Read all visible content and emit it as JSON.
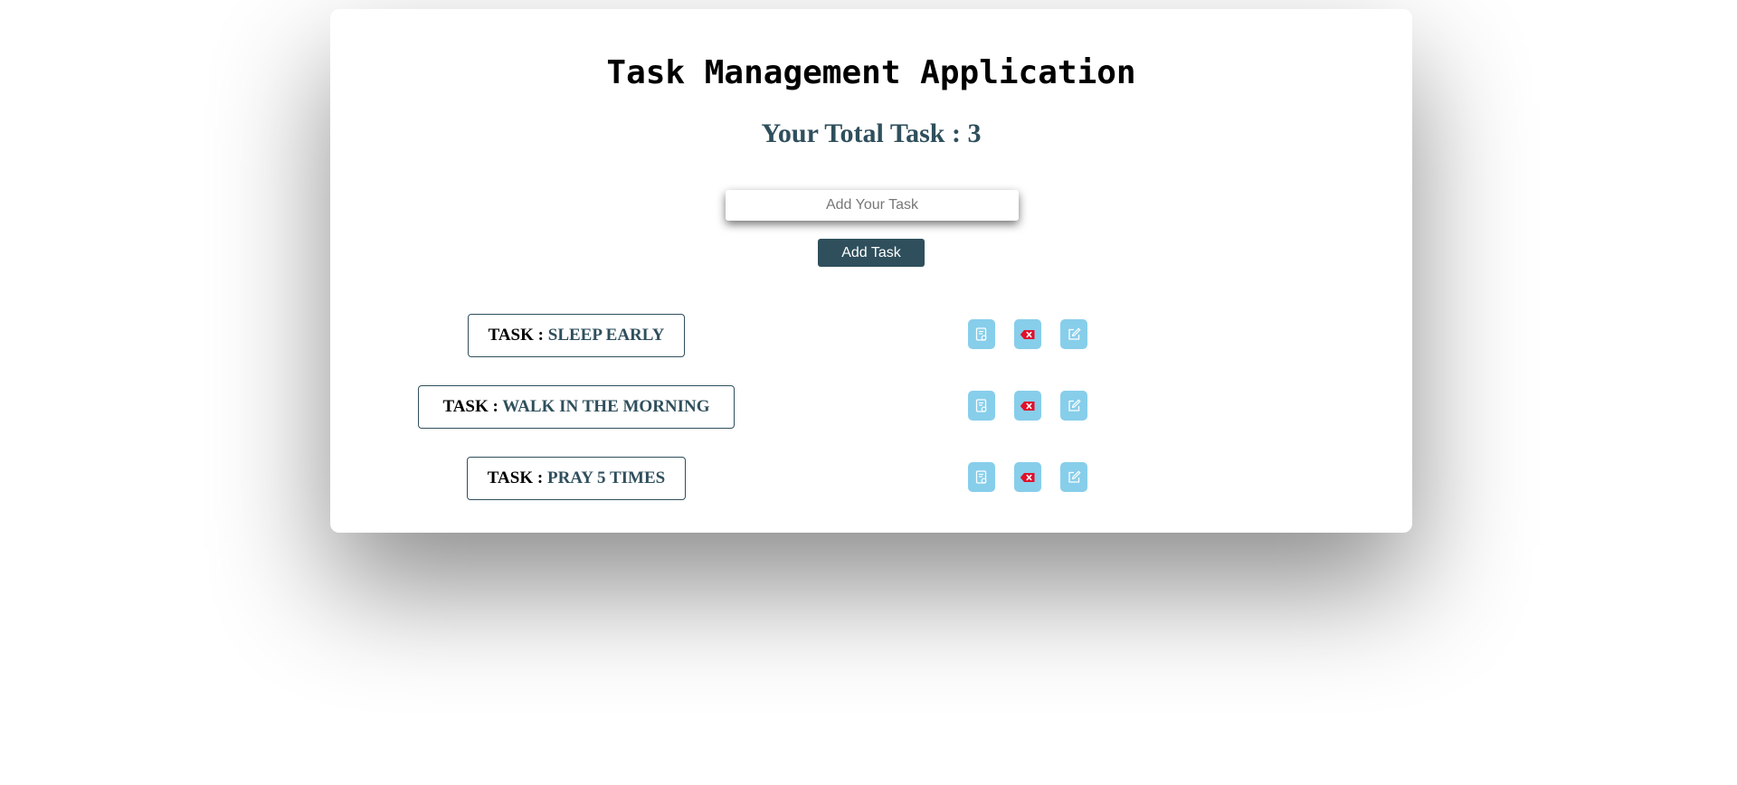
{
  "app": {
    "title": "Task Management Application",
    "total_label": "Your Total Task : 3"
  },
  "form": {
    "placeholder": "Add Your Task",
    "add_label": "Add Task"
  },
  "tasks": [
    {
      "prefix": "TASK :",
      "name": "SLEEP EARLY"
    },
    {
      "prefix": "TASK :",
      "name": "WALK IN THE MORNING"
    },
    {
      "prefix": "TASK :",
      "name": "PRAY 5 TIMES"
    }
  ],
  "actions": [
    "view-icon",
    "delete-icon",
    "edit-icon"
  ],
  "colors": {
    "accent": "#2f4f5c",
    "action_bg": "#87ceeb",
    "delete": "#e0102a"
  }
}
